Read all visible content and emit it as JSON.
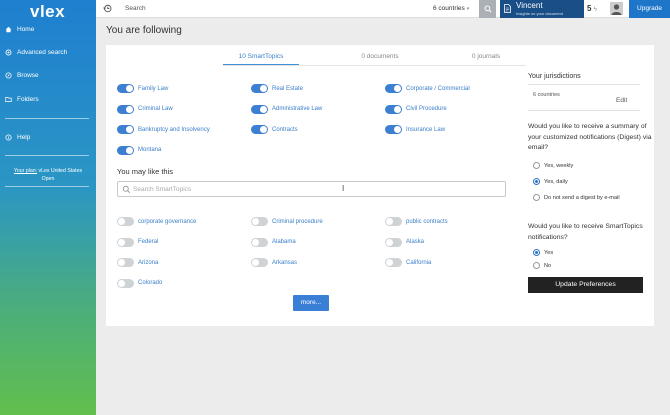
{
  "brand": {
    "logo": "vlex"
  },
  "sidebar": {
    "items": [
      {
        "label": "Home",
        "icon": "home-icon"
      },
      {
        "label": "Advanced search",
        "icon": "advanced-search-icon"
      },
      {
        "label": "Browse",
        "icon": "compass-icon"
      },
      {
        "label": "Folders",
        "icon": "folder-icon"
      },
      {
        "label": "Help",
        "icon": "help-icon"
      }
    ],
    "plan_link": "Your plan:",
    "plan_text": "vLex United States",
    "plan_status": "Open"
  },
  "topbar": {
    "search_label": "Search",
    "countries": "6 countries",
    "user_name": "Vincent",
    "user_sub": "Insights on your document",
    "counter": "5",
    "upgrade": "Upgrade"
  },
  "page": {
    "title": "You are following"
  },
  "tabs": [
    {
      "label": "10 SmartTopics",
      "active": true
    },
    {
      "label": "0 documents",
      "active": false
    },
    {
      "label": "0 journals",
      "active": false
    }
  ],
  "following": [
    {
      "label": "Family Law",
      "on": true
    },
    {
      "label": "Real Estate",
      "on": true
    },
    {
      "label": "Corporate / Commercial",
      "on": true
    },
    {
      "label": "Criminal Law",
      "on": true
    },
    {
      "label": "Administrative Law",
      "on": true
    },
    {
      "label": "Civil Procedure",
      "on": true
    },
    {
      "label": "Bankruptcy and Insolvency",
      "on": true
    },
    {
      "label": "Contracts",
      "on": true
    },
    {
      "label": "Insurance Law",
      "on": true
    },
    {
      "label": "Montana",
      "on": true
    }
  ],
  "suggestions": {
    "title": "You may like this",
    "search_placeholder": "Search SmartTopics",
    "items": [
      {
        "label": "corporate governance",
        "on": false
      },
      {
        "label": "Criminal procedure",
        "on": false
      },
      {
        "label": "public contracts",
        "on": false
      },
      {
        "label": "Federal",
        "on": false
      },
      {
        "label": "Alabama",
        "on": false
      },
      {
        "label": "Alaska",
        "on": false
      },
      {
        "label": "Arizona",
        "on": false
      },
      {
        "label": "Arkansas",
        "on": false
      },
      {
        "label": "California",
        "on": false
      },
      {
        "label": "Colorado",
        "on": false
      }
    ],
    "more_label": "more..."
  },
  "right_panel": {
    "jurisdictions_title": "Your jurisdictions",
    "jurisdictions_count": "6 countries",
    "edit_label": "Edit",
    "digest_question": "Would you like to receive a summary of your customized notifications (Digest) via email?",
    "digest_options": [
      {
        "label": "Yes, weekly",
        "selected": false
      },
      {
        "label": "Yes, daily",
        "selected": true
      },
      {
        "label": "Do not send a digest by e-mail",
        "selected": false
      }
    ],
    "notif_question": "Would you like to receive SmartTopics notifications?",
    "notif_options": [
      {
        "label": "Yes",
        "selected": true
      },
      {
        "label": "No",
        "selected": false
      }
    ],
    "update_label": "Update Preferences"
  },
  "colors": {
    "accent": "#3a7fd6",
    "toggle_on": "#3d7fd1",
    "toggle_off": "#cfd3d6",
    "user_box": "#1a4e87"
  }
}
